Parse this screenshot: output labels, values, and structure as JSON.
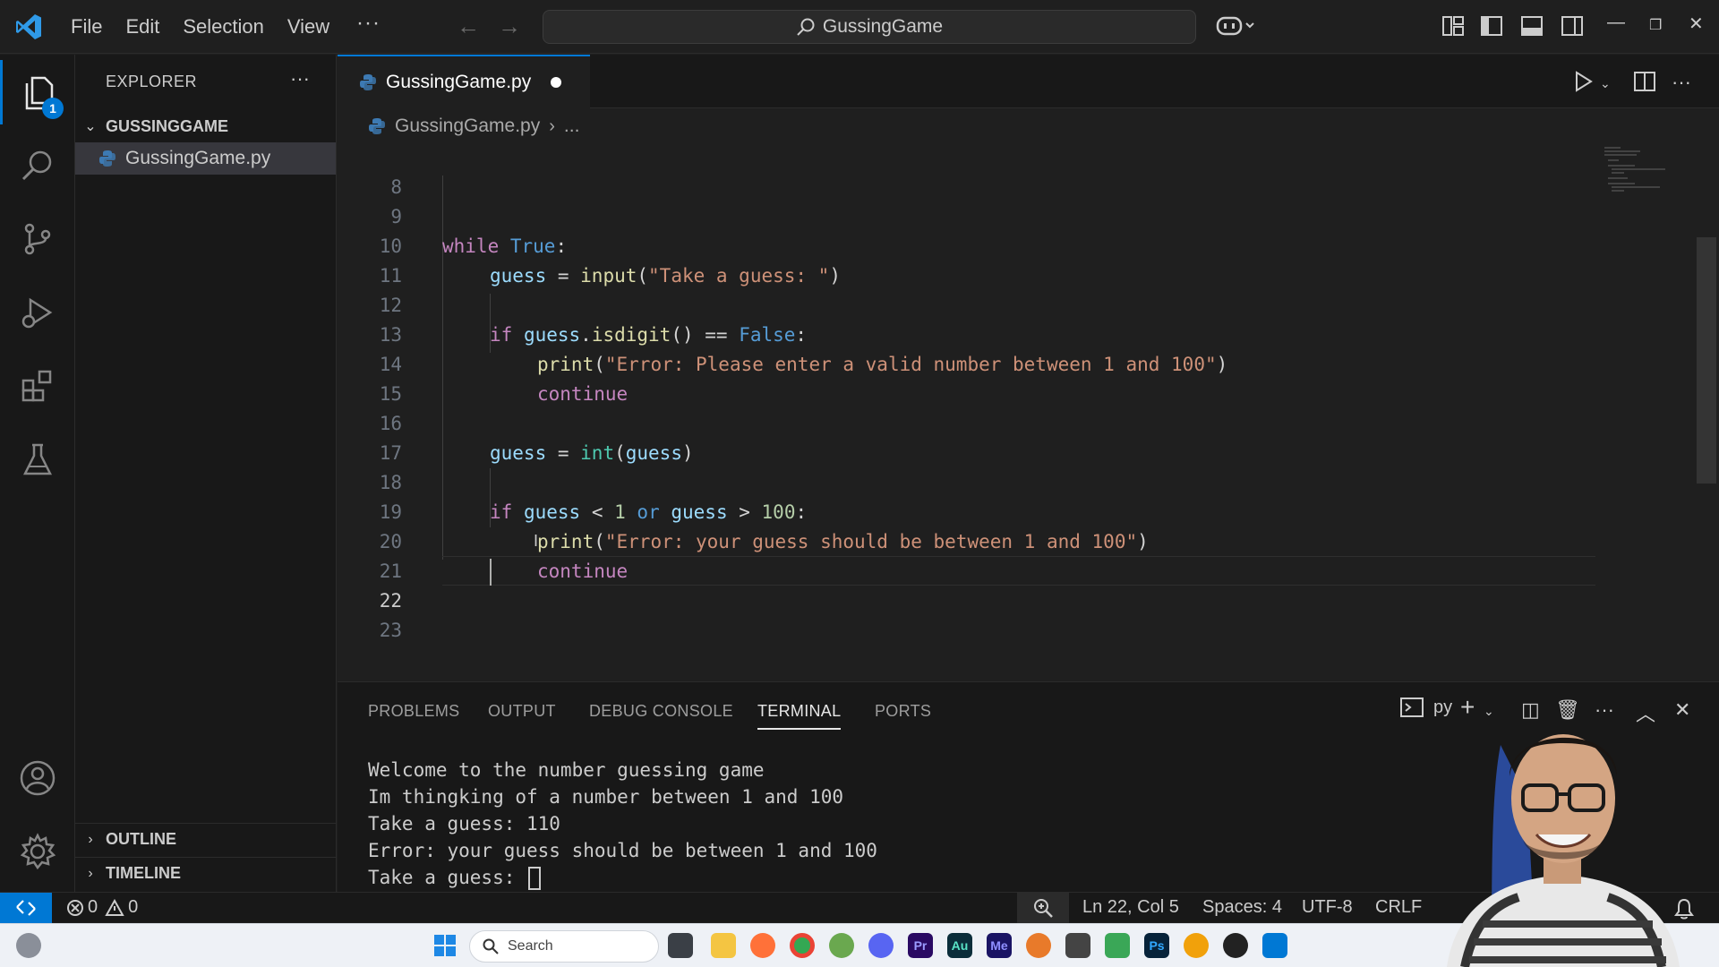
{
  "menu": [
    "File",
    "Edit",
    "Selection",
    "View"
  ],
  "search": {
    "text": "GussingGame"
  },
  "sidebar": {
    "title": "EXPLORER",
    "folder": "GUSSINGGAME",
    "file": "GussingGame.py",
    "outline": "OUTLINE",
    "timeline": "TIMELINE"
  },
  "activity": {
    "explorer_badge": "1"
  },
  "tab": {
    "label": "GussingGame.py"
  },
  "breadcrumb": {
    "file": "GussingGame.py",
    "more": "..."
  },
  "code": {
    "line_numbers": [
      "8",
      "9",
      "10",
      "11",
      "12",
      "13",
      "14",
      "15",
      "16",
      "17",
      "18",
      "19",
      "20",
      "21",
      "22",
      "23"
    ],
    "lines": {
      "l9": [
        "while",
        " ",
        "True",
        ":"
      ],
      "l10": [
        "guess",
        " = ",
        "input",
        "(",
        "\"Take a guess: \"",
        ")"
      ],
      "l12": [
        "if",
        " ",
        "guess",
        ".",
        "isdigit",
        "() == ",
        "False",
        ":"
      ],
      "l13": [
        "print",
        "(",
        "\"Error: Please enter a valid number between 1 and 100\"",
        ")"
      ],
      "l14": [
        "continue"
      ],
      "l16": [
        "guess",
        " = ",
        "int",
        "(",
        "guess",
        ")"
      ],
      "l18": [
        "if",
        " ",
        "guess",
        " < ",
        "1",
        " ",
        "or",
        " ",
        "guess",
        " > ",
        "100",
        ":"
      ],
      "l19": [
        "print",
        "(",
        "\"Error: your guess should be between 1 and 100\"",
        ")"
      ],
      "l20": [
        "continue"
      ]
    }
  },
  "panel": {
    "tabs": [
      "PROBLEMS",
      "OUTPUT",
      "DEBUG CONSOLE",
      "TERMINAL",
      "PORTS"
    ],
    "active_tab": "TERMINAL",
    "shell": "py",
    "terminal": [
      "Welcome to the number guessing game",
      "Im thingking of a number between 1 and 100",
      "Take a guess: 110",
      "Error: your guess should be between 1 and 100",
      "Take a guess: "
    ]
  },
  "status": {
    "errors": "0",
    "warnings": "0",
    "position": "Ln 22, Col 5",
    "spaces": "Spaces: 4",
    "encoding": "UTF-8",
    "eol": "CRLF"
  },
  "taskbar": {
    "search_placeholder": "Search"
  },
  "colors": {
    "accent": "#0078d4",
    "keyword": "#c586c0",
    "constant": "#569cd6",
    "identifier": "#9cdcfe",
    "function": "#dcdcaa",
    "string": "#ce9178",
    "number": "#b5cea8",
    "builtin": "#4ec9b0"
  }
}
